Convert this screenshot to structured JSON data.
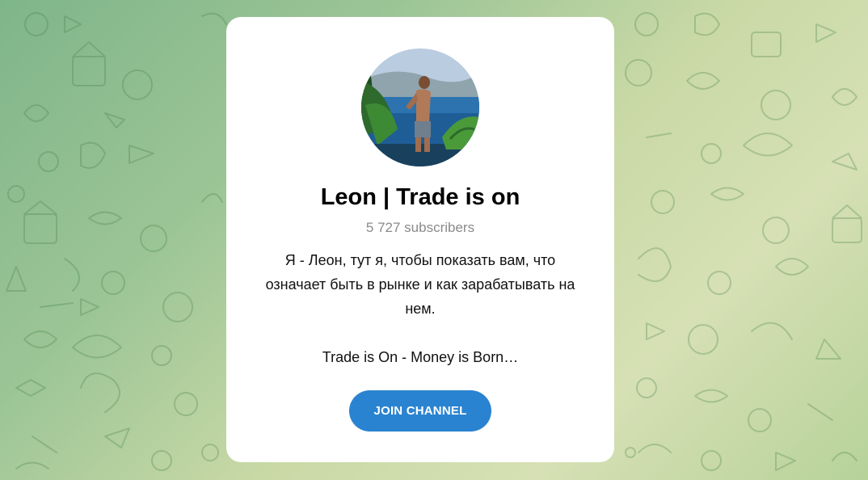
{
  "channel": {
    "title": "Leon | Trade is on",
    "subscribers": "5 727 subscribers",
    "description_lines": [
      "Я - Леон, тут я, чтобы показать вам, что",
      "означает быть в рынке и как зарабатывать на",
      "нем.",
      "Trade is On - Money is Born…"
    ],
    "join_label": "JOIN CHANNEL"
  },
  "colors": {
    "accent": "#2a83d0",
    "background": "#9cc596",
    "card": "#ffffff"
  },
  "icons": {
    "background": "doodle-pattern-icon",
    "avatar": "channel-avatar"
  }
}
